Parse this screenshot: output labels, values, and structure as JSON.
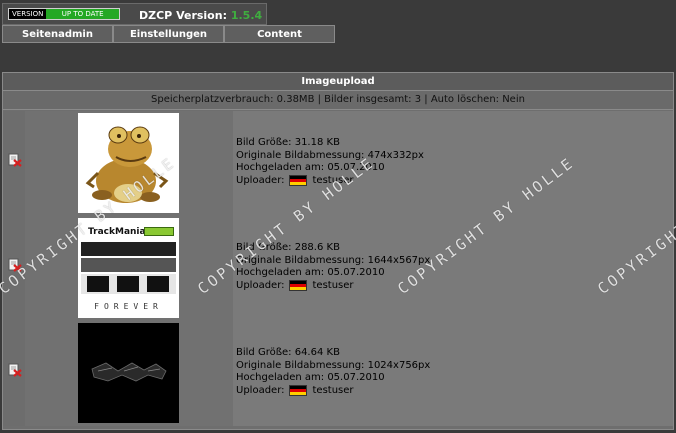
{
  "header": {
    "badge_left": "VERSION",
    "badge_right": "UP TO DATE",
    "app_label": "DZCP Version:",
    "version": "1.5.4"
  },
  "nav": {
    "tabs": [
      {
        "label": "Seitenadmin"
      },
      {
        "label": "Einstellungen"
      },
      {
        "label": "Content"
      }
    ]
  },
  "panel": {
    "title": "Imageupload",
    "stats": "Speicherplatzverbrauch: 0.38MB | Bilder insgesamt: 3 | Auto löschen: Nein",
    "images": [
      {
        "size": "Bild Größe: 31.18 KB",
        "dimensions": "Originale Bildabmessung: 474x332px",
        "uploaded": "Hochgeladen am: 05.07.2010",
        "uploader_label": "Uploader:",
        "uploader": "testuser"
      },
      {
        "size": "Bild Größe: 288.6 KB",
        "dimensions": "Originale Bildabmessung: 1644x567px",
        "uploaded": "Hochgeladen am: 05.07.2010",
        "uploader_label": "Uploader:",
        "uploader": "testuser",
        "thumb_text_top": "TrackMania",
        "thumb_text_bottom": "FOREVER"
      },
      {
        "size": "Bild Größe: 64.64 KB",
        "dimensions": "Originale Bildabmessung: 1024x756px",
        "uploaded": "Hochgeladen am: 05.07.2010",
        "uploader_label": "Uploader:",
        "uploader": "testuser"
      }
    ]
  },
  "watermark": "COPYRIGHT BY HOLLE",
  "colors": {
    "version_green": "#3fae3f",
    "badge_green": "#23a823",
    "delete_red": "#d62020"
  }
}
